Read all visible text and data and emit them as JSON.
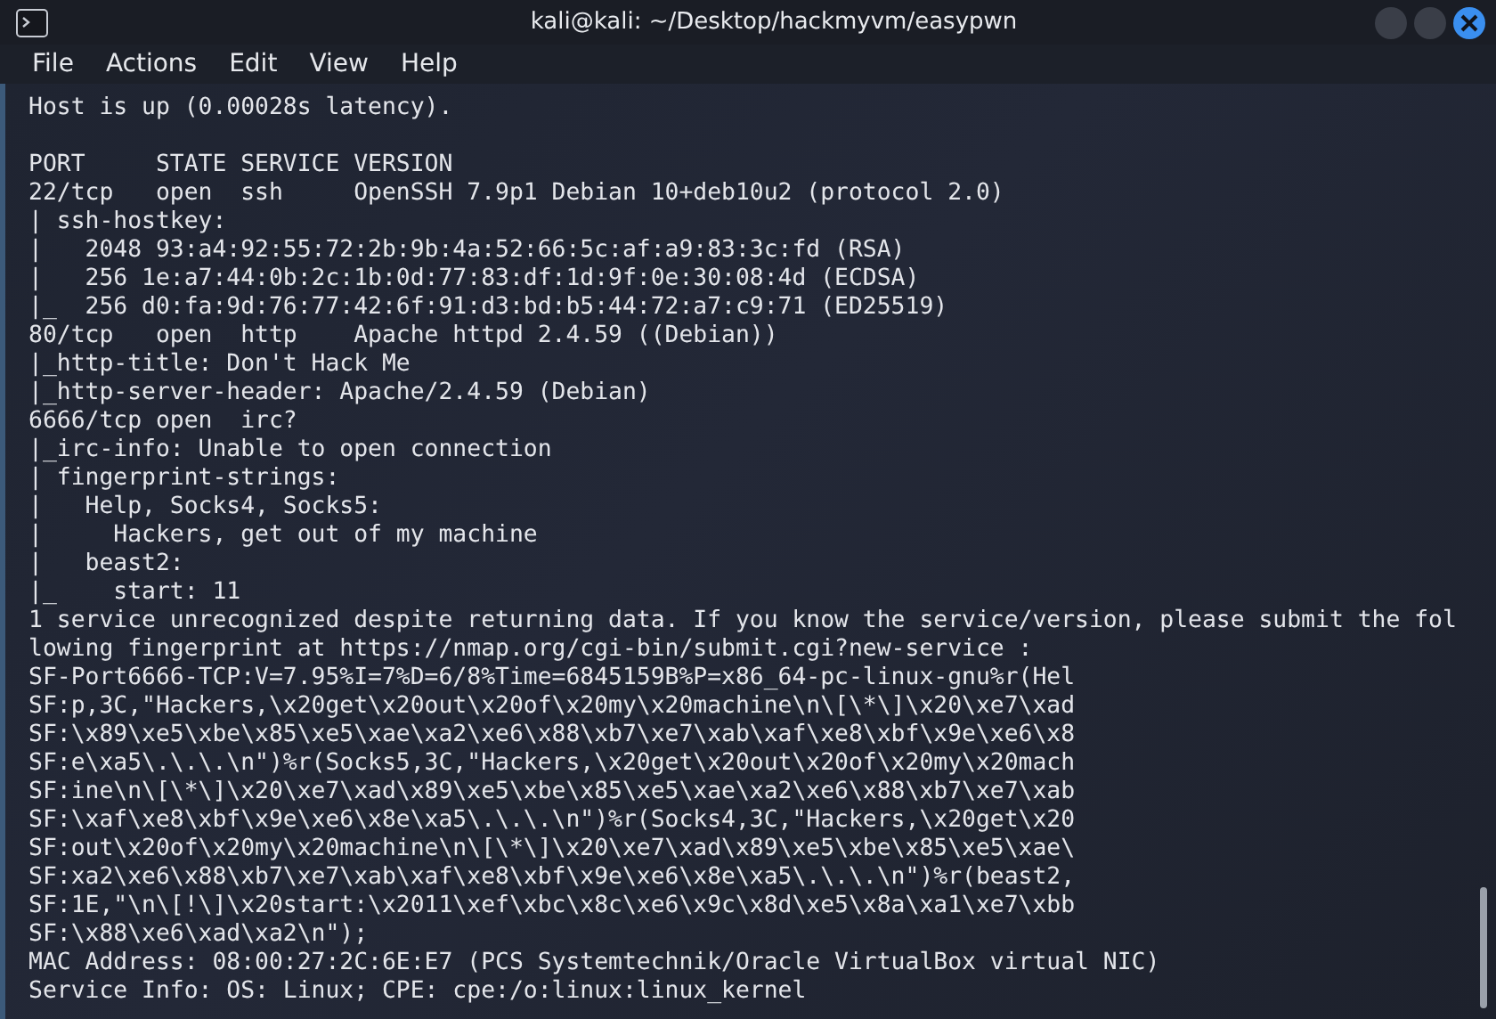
{
  "window": {
    "title": "kali@kali: ~/Desktop/hackmyvm/easypwn"
  },
  "menu": [
    "File",
    "Actions",
    "Edit",
    "View",
    "Help"
  ],
  "blocks": [
    {
      "lines": [
        "Host is up (0.00028s latency)."
      ]
    },
    {
      "lines": [
        "PORT     STATE SERVICE VERSION",
        "22/tcp   open  ssh     OpenSSH 7.9p1 Debian 10+deb10u2 (protocol 2.0)",
        "| ssh-hostkey:",
        "|   2048 93:a4:92:55:72:2b:9b:4a:52:66:5c:af:a9:83:3c:fd (RSA)",
        "|   256 1e:a7:44:0b:2c:1b:0d:77:83:df:1d:9f:0e:30:08:4d (ECDSA)",
        "|_  256 d0:fa:9d:76:77:42:6f:91:d3:bd:b5:44:72:a7:c9:71 (ED25519)",
        "80/tcp   open  http    Apache httpd 2.4.59 ((Debian))",
        "|_http-title: Don't Hack Me",
        "|_http-server-header: Apache/2.4.59 (Debian)",
        "6666/tcp open  irc?",
        "|_irc-info: Unable to open connection",
        "| fingerprint-strings:",
        "|   Help, Socks4, Socks5:",
        "|     Hackers, get out of my machine",
        "|   beast2:",
        "|_    start: 11",
        "1 service unrecognized despite returning data. If you know the service/version, please submit the fol",
        "lowing fingerprint at https://nmap.org/cgi-bin/submit.cgi?new-service :",
        "SF-Port6666-TCP:V=7.95%I=7%D=6/8%Time=6845159B%P=x86_64-pc-linux-gnu%r(Hel",
        "SF:p,3C,\"Hackers,\\x20get\\x20out\\x20of\\x20my\\x20machine\\n\\[\\*\\]\\x20\\xe7\\xad",
        "SF:\\x89\\xe5\\xbe\\x85\\xe5\\xae\\xa2\\xe6\\x88\\xb7\\xe7\\xab\\xaf\\xe8\\xbf\\x9e\\xe6\\x8",
        "SF:e\\xa5\\.\\.\\.\\n\")%r(Socks5,3C,\"Hackers,\\x20get\\x20out\\x20of\\x20my\\x20mach",
        "SF:ine\\n\\[\\*\\]\\x20\\xe7\\xad\\x89\\xe5\\xbe\\x85\\xe5\\xae\\xa2\\xe6\\x88\\xb7\\xe7\\xab",
        "SF:\\xaf\\xe8\\xbf\\x9e\\xe6\\x8e\\xa5\\.\\.\\.\\n\")%r(Socks4,3C,\"Hackers,\\x20get\\x20",
        "SF:out\\x20of\\x20my\\x20machine\\n\\[\\*\\]\\x20\\xe7\\xad\\x89\\xe5\\xbe\\x85\\xe5\\xae\\",
        "SF:xa2\\xe6\\x88\\xb7\\xe7\\xab\\xaf\\xe8\\xbf\\x9e\\xe6\\x8e\\xa5\\.\\.\\.\\n\")%r(beast2,",
        "SF:1E,\"\\n\\[!\\]\\x20start:\\x2011\\xef\\xbc\\x8c\\xe6\\x9c\\x8d\\xe5\\x8a\\xa1\\xe7\\xbb",
        "SF:\\x88\\xe6\\xad\\xa2\\n\");",
        "MAC Address: 08:00:27:2C:6E:E7 (PCS Systemtechnik/Oracle VirtualBox virtual NIC)",
        "Service Info: OS: Linux; CPE: cpe:/o:linux:linux_kernel"
      ]
    }
  ]
}
